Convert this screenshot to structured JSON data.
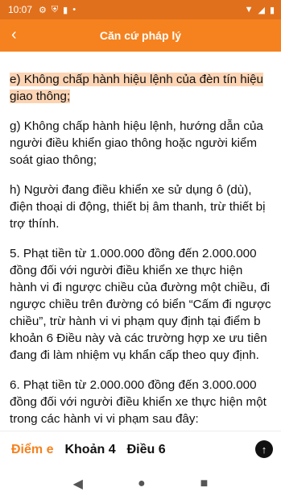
{
  "status": {
    "time": "10:07",
    "left_icons": [
      "gear-icon",
      "shield-icon",
      "sim-icon",
      "dot-icon"
    ],
    "right_icons": [
      "wifi-icon",
      "signal-icon",
      "battery-icon"
    ]
  },
  "appbar": {
    "back_icon": "‹",
    "title": "Căn cứ pháp lý"
  },
  "content": {
    "paragraphs": [
      "e) Không chấp hành hiệu lệnh của đèn tín hiệu giao thông;",
      "g) Không chấp hành hiệu lệnh, hướng dẫn của người điều khiển giao thông hoặc người kiểm soát giao thông;",
      "h) Người đang điều khiển xe sử dụng ô (dù), điện thoại di động, thiết bị âm thanh, trừ thiết bị trợ thính.",
      "5. Phạt tiền từ 1.000.000 đồng đến 2.000.000 đồng đối với người điều khiển xe thực hiện hành vi đi ngược chiều của đường một chiều, đi ngược chiều trên đường có biển “Cấm đi ngược chiều”, trừ hành vi vi phạm quy định tại điểm b khoản 6 Điều này và các trường hợp xe ưu tiên đang đi làm nhiệm vụ khẩn cấp theo quy định.",
      "6. Phạt tiền từ 2.000.000 đồng đến 3.000.000 đồng đối với người điều khiển xe thực hiện một trong các hành vi vi phạm sau đây:"
    ]
  },
  "bottom": {
    "tabs": [
      "Điểm e",
      "Khoản 4",
      "Điều 6"
    ],
    "up_icon": "↑"
  },
  "navbar": {
    "back": "◀",
    "home": "●",
    "recents": "■"
  },
  "colors": {
    "accent": "#f5821f",
    "statusbar": "#e1701c",
    "highlight": "#fcd4b4"
  }
}
